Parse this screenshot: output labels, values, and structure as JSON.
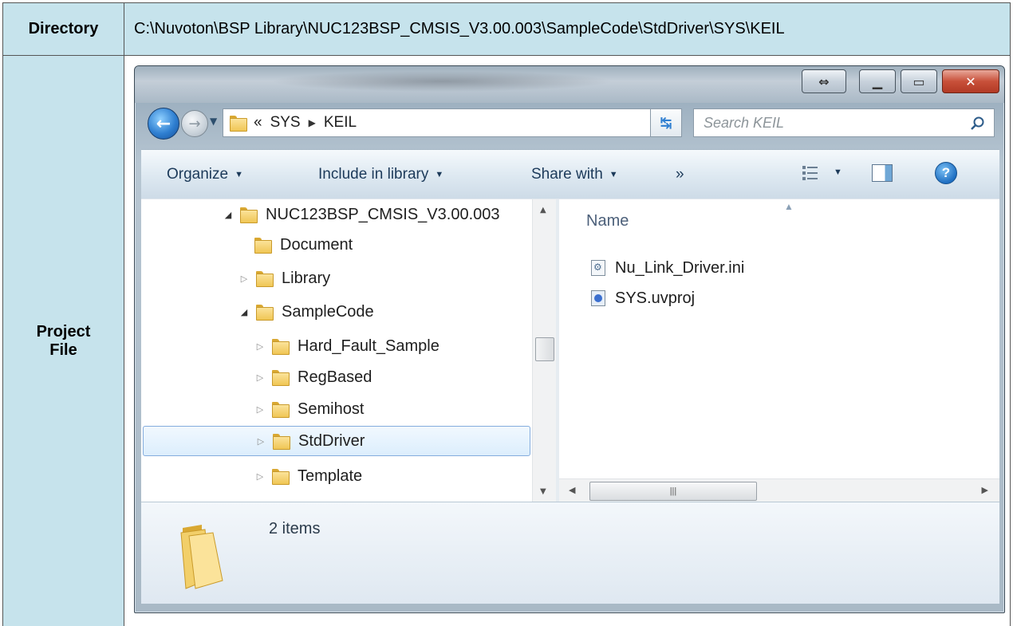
{
  "table": {
    "directory_label": "Directory",
    "directory_value": "C:\\Nuvoton\\BSP Library\\NUC123BSP_CMSIS_V3.00.003\\SampleCode\\StdDriver\\SYS\\KEIL",
    "project_file_label": "Project File"
  },
  "explorer": {
    "address": {
      "prefix": "«",
      "crumbs": [
        "SYS",
        "KEIL"
      ]
    },
    "search_placeholder": "Search KEIL",
    "toolbar": {
      "organize": "Organize",
      "include_in_library": "Include in library",
      "share_with": "Share with",
      "more": "»"
    },
    "tree": [
      {
        "label": "NUC123BSP_CMSIS_V3.00.003",
        "state": "expanded"
      },
      {
        "label": "Document",
        "state": "none"
      },
      {
        "label": "Library",
        "state": "collapsed"
      },
      {
        "label": "SampleCode",
        "state": "expanded"
      },
      {
        "label": "Hard_Fault_Sample",
        "state": "collapsed"
      },
      {
        "label": "RegBased",
        "state": "collapsed"
      },
      {
        "label": "Semihost",
        "state": "collapsed"
      },
      {
        "label": "StdDriver",
        "state": "collapsed",
        "selected": true
      },
      {
        "label": "Template",
        "state": "collapsed"
      }
    ],
    "file_list": {
      "column_name": "Name",
      "files": [
        {
          "name": "Nu_Link_Driver.ini",
          "icon": "ini-file-icon"
        },
        {
          "name": "SYS.uvproj",
          "icon": "uvproj-file-icon"
        }
      ]
    },
    "details": {
      "item_count": "2 items"
    }
  },
  "colors": {
    "table_header_bg": "#c6e3ec",
    "selection": "#dceefd"
  }
}
